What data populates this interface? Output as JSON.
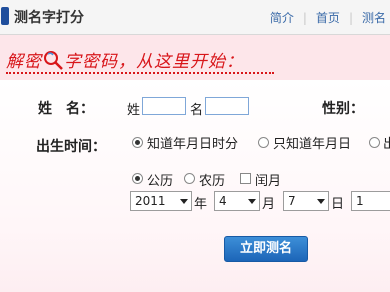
{
  "header": {
    "title": "测名字打分",
    "nav": [
      {
        "label": "简介"
      },
      {
        "label": "首页"
      },
      {
        "label": "测名"
      }
    ]
  },
  "banner": {
    "slogan_left": "解密",
    "slogan_right": "字密码，从这里开始："
  },
  "form": {
    "name_label": "姓　名：",
    "surname_prefix": "姓",
    "surname_value": "",
    "given_prefix": "名",
    "given_value": "",
    "gender_label": "性别：",
    "birth_label": "出生时间：",
    "time_mode_options": [
      {
        "label": "知道年月日时分",
        "selected": true
      },
      {
        "label": "只知道年月日",
        "selected": false
      },
      {
        "label": "出",
        "selected": false
      }
    ],
    "calendar_options": [
      {
        "label": "公历",
        "selected": true
      },
      {
        "label": "农历",
        "selected": false
      }
    ],
    "leap_month_label": "闰月",
    "leap_month_checked": false,
    "year_value": "2011",
    "year_unit": "年",
    "month_value": "4",
    "month_unit": "月",
    "day_value": "7",
    "day_unit": "日",
    "hour_value": "1",
    "submit_label": "立即测名"
  },
  "colors": {
    "accent_red": "#d8161a",
    "button_blue": "#1c65b8",
    "banner_pink": "#fde6ea"
  }
}
